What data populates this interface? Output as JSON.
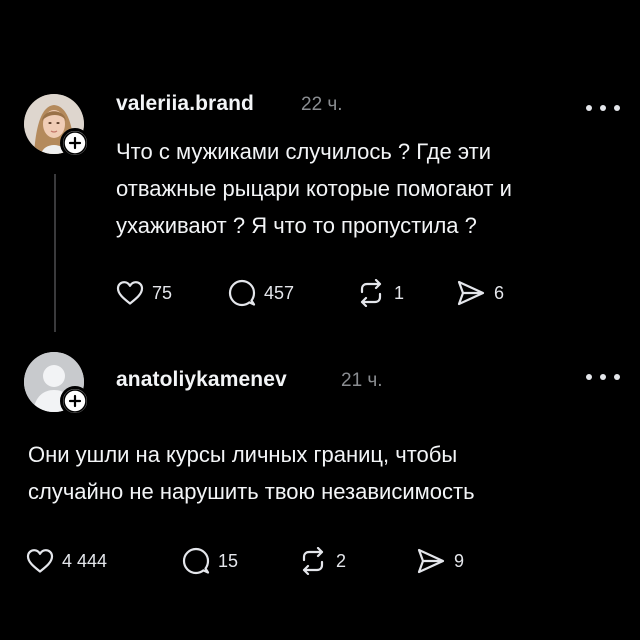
{
  "posts": [
    {
      "username": "valeriia.brand",
      "time": "22 ч.",
      "text_lines": [
        "Что с мужиками случилось ? Где эти",
        "отважные рыцари которые помогают и",
        "ухаживают ? Я что то пропустила ?"
      ],
      "likes": "75",
      "comments": "457",
      "reposts": "1",
      "shares": "6",
      "avatar": "profile-photo",
      "badge_icon": "plus-icon"
    },
    {
      "username": "anatoliykamenev",
      "time": "21 ч.",
      "text_lines": [
        "Они ушли на курсы личных границ, чтобы",
        "случайно не нарушить твою независимость"
      ],
      "likes": "4 444",
      "comments": "15",
      "reposts": "2",
      "shares": "9",
      "avatar": "default-avatar",
      "badge_icon": "plus-icon"
    }
  ],
  "icons": {
    "like": "heart-icon",
    "comment": "comment-bubble-icon",
    "repost": "repost-icon",
    "share": "send-icon",
    "more": "more-dots-icon"
  },
  "colors": {
    "background": "#000000",
    "text": "#f3f5f7",
    "muted": "#8a8d91",
    "thread_line": "#3a3a3c"
  }
}
